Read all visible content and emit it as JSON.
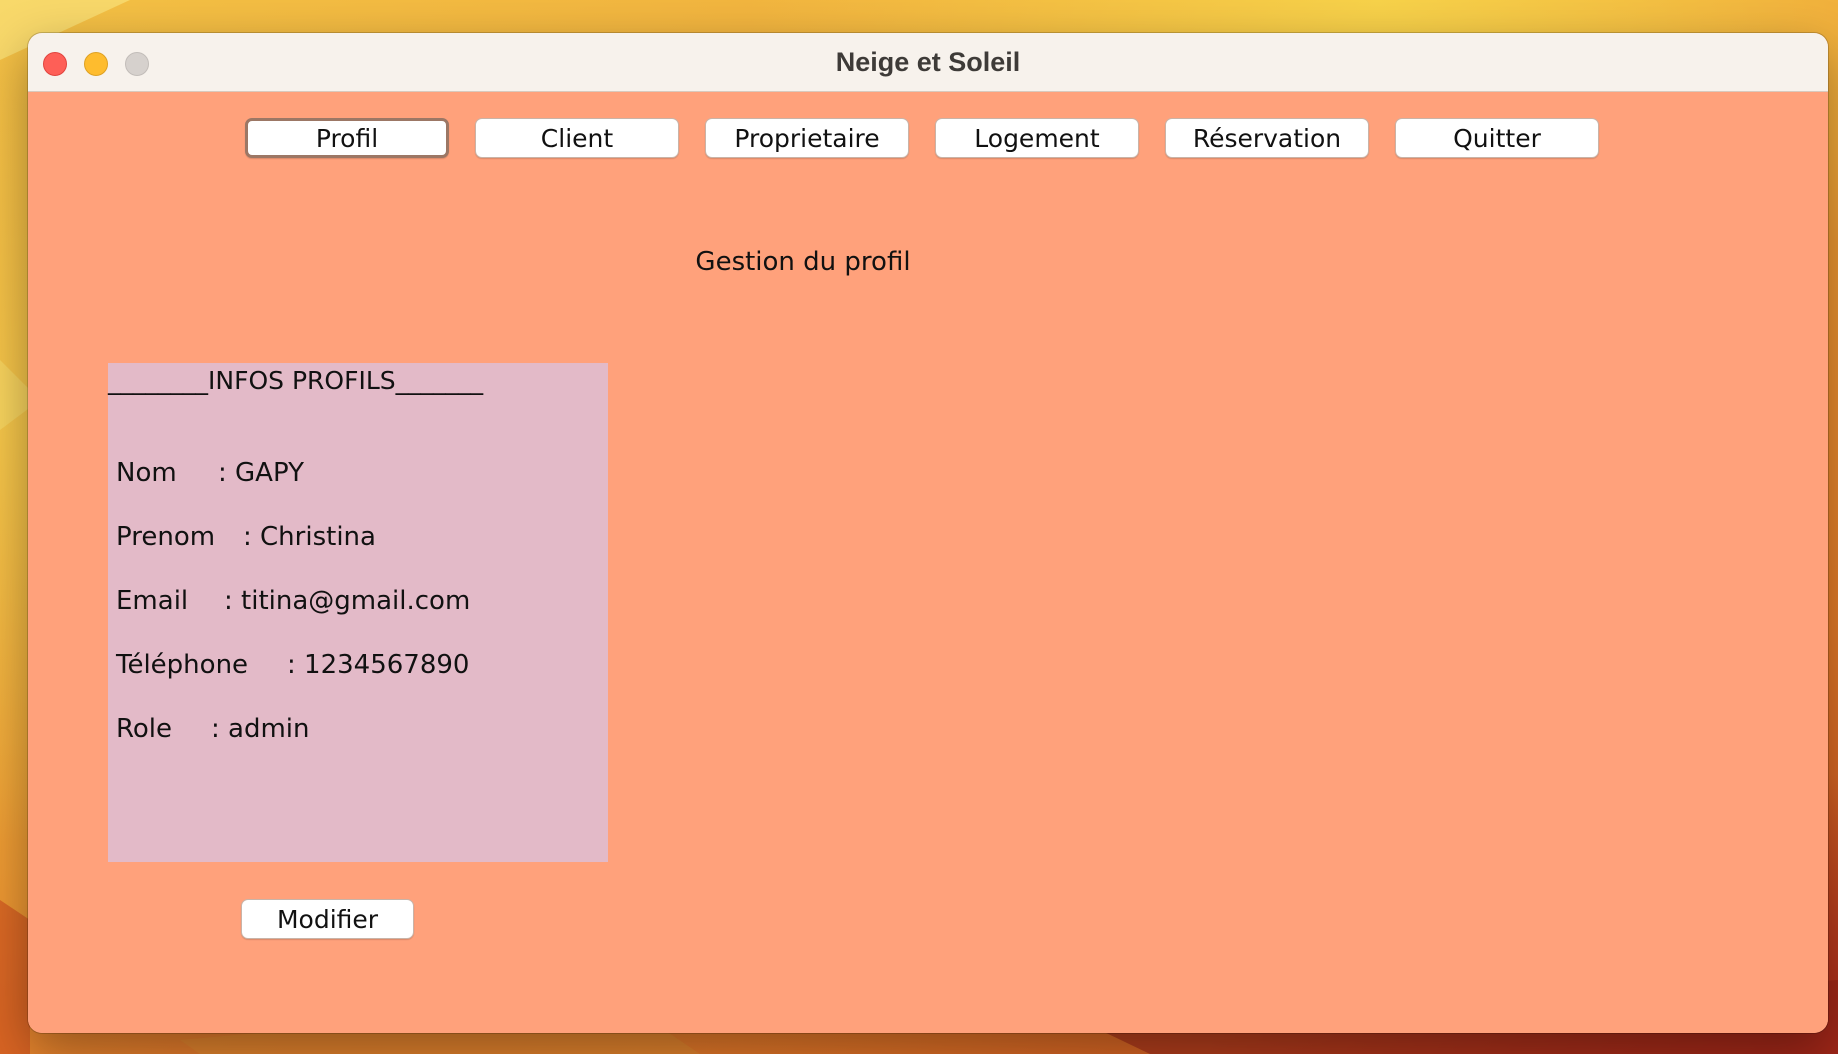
{
  "window": {
    "title": "Neige et Soleil"
  },
  "tabs": [
    {
      "label": "Profil",
      "active": true
    },
    {
      "label": "Client",
      "active": false
    },
    {
      "label": "Proprietaire",
      "active": false
    },
    {
      "label": "Logement",
      "active": false
    },
    {
      "label": "Réservation",
      "active": false
    },
    {
      "label": "Quitter",
      "active": false
    }
  ],
  "main": {
    "section_title": "Gestion du profil",
    "infos": {
      "header": "________INFOS PROFILS_______",
      "rows": [
        {
          "label": "Nom",
          "value": "GAPY"
        },
        {
          "label": "Prenom",
          "value": "Christina"
        },
        {
          "label": "Email",
          "value": "titina@gmail.com"
        },
        {
          "label": "Téléphone",
          "value": "1234567890"
        },
        {
          "label": "Role",
          "value": "admin"
        }
      ]
    },
    "modify_label": "Modifier"
  },
  "colors": {
    "content_background": "#ffa17b",
    "infos_panel_background": "#e3bac8",
    "titlebar_background": "#f7f2ec"
  }
}
